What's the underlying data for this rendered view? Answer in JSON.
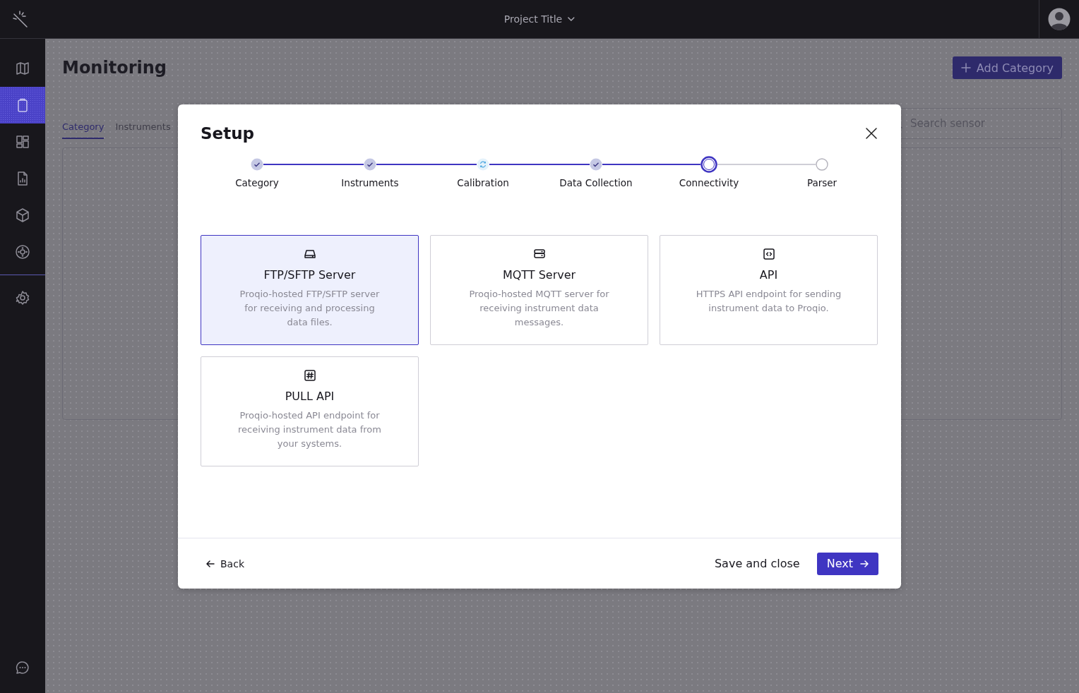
{
  "topbar": {
    "project_title": "Project Title"
  },
  "sidebar": {
    "items": [
      {
        "selected": false
      },
      {
        "selected": true
      },
      {
        "selected": false
      },
      {
        "selected": false
      },
      {
        "selected": false
      },
      {
        "selected": false
      }
    ]
  },
  "page": {
    "title": "Monitoring",
    "add_button": "Add Category",
    "tabs": [
      {
        "label": "Category",
        "selected": true
      },
      {
        "label": "Instruments",
        "selected": false
      }
    ],
    "search": {
      "placeholder": "Search sensor"
    }
  },
  "modal": {
    "title": "Setup",
    "steps": [
      {
        "label": "Category",
        "completed": true,
        "in_progress": false,
        "current": false
      },
      {
        "label": "Instruments",
        "completed": true,
        "in_progress": false,
        "current": false
      },
      {
        "label": "Calibration",
        "completed": false,
        "in_progress": true,
        "current": false
      },
      {
        "label": "Data Collection",
        "completed": true,
        "in_progress": false,
        "current": false
      },
      {
        "label": "Connectivity",
        "completed": false,
        "in_progress": false,
        "current": true
      },
      {
        "label": "Parser",
        "completed": false,
        "in_progress": false,
        "current": false
      }
    ],
    "options": [
      {
        "title": "FTP/SFTP Server",
        "description": "Proqio-hosted FTP/SFTP server for receiving and processing data files.",
        "selected": true
      },
      {
        "title": "MQTT Server",
        "description": "Proqio-hosted MQTT server for receiving instrument data messages.",
        "selected": false
      },
      {
        "title": "API",
        "description": "HTTPS API endpoint for sending instrument data to Proqio.",
        "selected": false
      },
      {
        "title": "PULL API",
        "description": "Proqio-hosted API endpoint for receiving instrument data from your systems.",
        "selected": false
      }
    ],
    "back": "Back",
    "save": "Save and close",
    "next": "Next"
  }
}
